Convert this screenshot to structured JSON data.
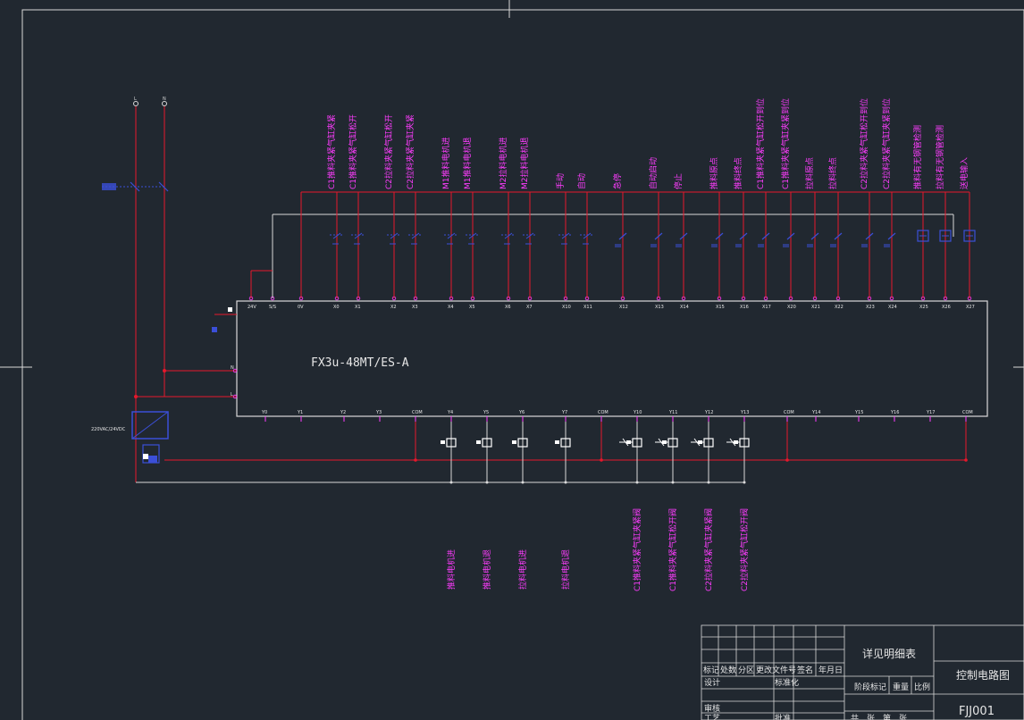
{
  "colors": {
    "background": "#212830",
    "frame": "#d9d9d9",
    "wire": "#e8172b",
    "plc_box": "#d9d9d9",
    "label": "#ff3cff",
    "component": "#3b4fd8",
    "table_text": "#e6e6e6"
  },
  "plc": {
    "model": "FX3u-48MT/ES-A",
    "top_terminals": [
      "24V",
      "S/S",
      "0V",
      "X0",
      "X1",
      "X2",
      "X3",
      "X4",
      "X5",
      "X6",
      "X7",
      "X10",
      "X11",
      "X12",
      "X13",
      "X14",
      "X15",
      "X16",
      "X17",
      "X20",
      "X21",
      "X22",
      "X23",
      "X24",
      "X25",
      "X26",
      "X27"
    ],
    "bottom_terminals": [
      "Y0",
      "Y1",
      "Y2",
      "Y3",
      "COM",
      "Y4",
      "Y5",
      "Y6",
      "Y7",
      "COM",
      "Y10",
      "Y11",
      "Y12",
      "Y13",
      "COM",
      "Y14",
      "Y15",
      "Y16",
      "Y17",
      "COM"
    ],
    "side_terminals": [
      "N",
      "L"
    ]
  },
  "inputs": [
    "C1推料夹紧气缸夹紧",
    "C1推料夹紧气缸松开",
    "C2拉料夹紧气缸松开",
    "C2拉料夹紧气缸夹紧",
    "M1推料电机进",
    "M1推料电机退",
    "M2拉料电机进",
    "M2拉料电机退",
    "手动",
    "自动",
    "急停",
    "自动启动",
    "停止",
    "推料原点",
    "推料终点",
    "C1推料夹紧气缸松开到位",
    "C1推料夹紧气缸夹紧到位",
    "拉料原点",
    "拉料终点",
    "C2拉料夹紧气缸松开到位",
    "C2拉料夹紧气缸夹紧到位",
    "推料有无钢管检测",
    "拉料有无钢管检测",
    "送电输入"
  ],
  "outputs": [
    "推料电机进",
    "推料电机退",
    "拉料电机进",
    "拉料电机退",
    "C1推料夹紧气缸夹紧阀",
    "C1推料夹紧气缸松开阀",
    "C2拉料夹紧气缸夹紧阀",
    "C2拉料夹紧气缸松开阀"
  ],
  "power": {
    "phase_marks": [
      "L",
      "N"
    ],
    "supply_label": "220VAC/24VDC"
  },
  "title_block": {
    "header_cols": [
      "标记",
      "处数",
      "分区",
      "更改文件号",
      "签名",
      "年月日"
    ],
    "row_labels": [
      "设计",
      "标准化",
      "审核",
      "工艺",
      "批准"
    ],
    "material": "详见明细表",
    "stage_cols": [
      "阶段标记",
      "重量",
      "比例"
    ],
    "sheet_row": [
      "共",
      "张",
      "第",
      "张"
    ],
    "drawing_name": "控制电路图",
    "drawing_no": "FJJ001"
  }
}
